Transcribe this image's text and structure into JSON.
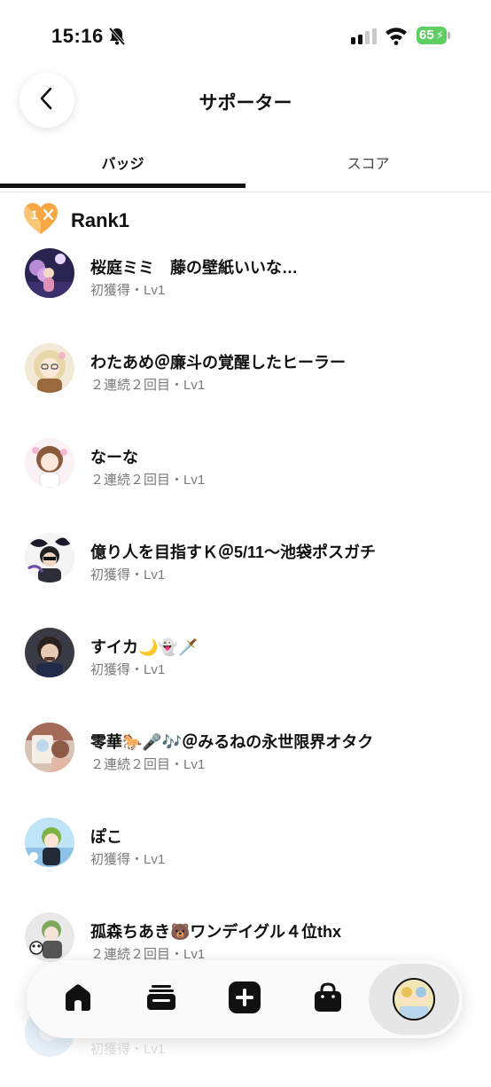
{
  "status_bar": {
    "time": "15:16",
    "battery": "65"
  },
  "header": {
    "title": "サポーター"
  },
  "tabs": [
    {
      "label": "バッジ",
      "active": true
    },
    {
      "label": "スコア",
      "active": false
    }
  ],
  "rank": {
    "label": "Rank1",
    "badge_number": "1"
  },
  "supporters": [
    {
      "name": "桜庭ミミ　藤の壁紙いいな…",
      "detail": "初獲得・Lv1"
    },
    {
      "name": "わたあめ＠廉斗の覚醒したヒーラー",
      "detail": "２連続２回目・Lv1"
    },
    {
      "name": "なーな",
      "detail": "２連続２回目・Lv1"
    },
    {
      "name": "億り人を目指すＫ＠5/11～池袋ポスガチ",
      "detail": "初獲得・Lv1"
    },
    {
      "name": "すイカ🌙👻🗡️",
      "detail": "初獲得・Lv1"
    },
    {
      "name": "零華🐎🎤🎶＠みるねの永世限界オタク",
      "detail": "２連続２回目・Lv1"
    },
    {
      "name": "ぽこ",
      "detail": "初獲得・Lv1"
    },
    {
      "name": "孤森ちあき🐻ワンデイグル４位thx",
      "detail": "２連続２回目・Lv1"
    },
    {
      "name": "",
      "detail": "初獲得・Lv1"
    }
  ],
  "colors": {
    "accent": "#111111",
    "badge_orange": "#f7a844",
    "battery_green": "#5fcf63"
  },
  "icons": {
    "nav": [
      "home-icon",
      "stack-icon",
      "plus-icon",
      "bag-icon",
      "profile-avatar"
    ]
  }
}
